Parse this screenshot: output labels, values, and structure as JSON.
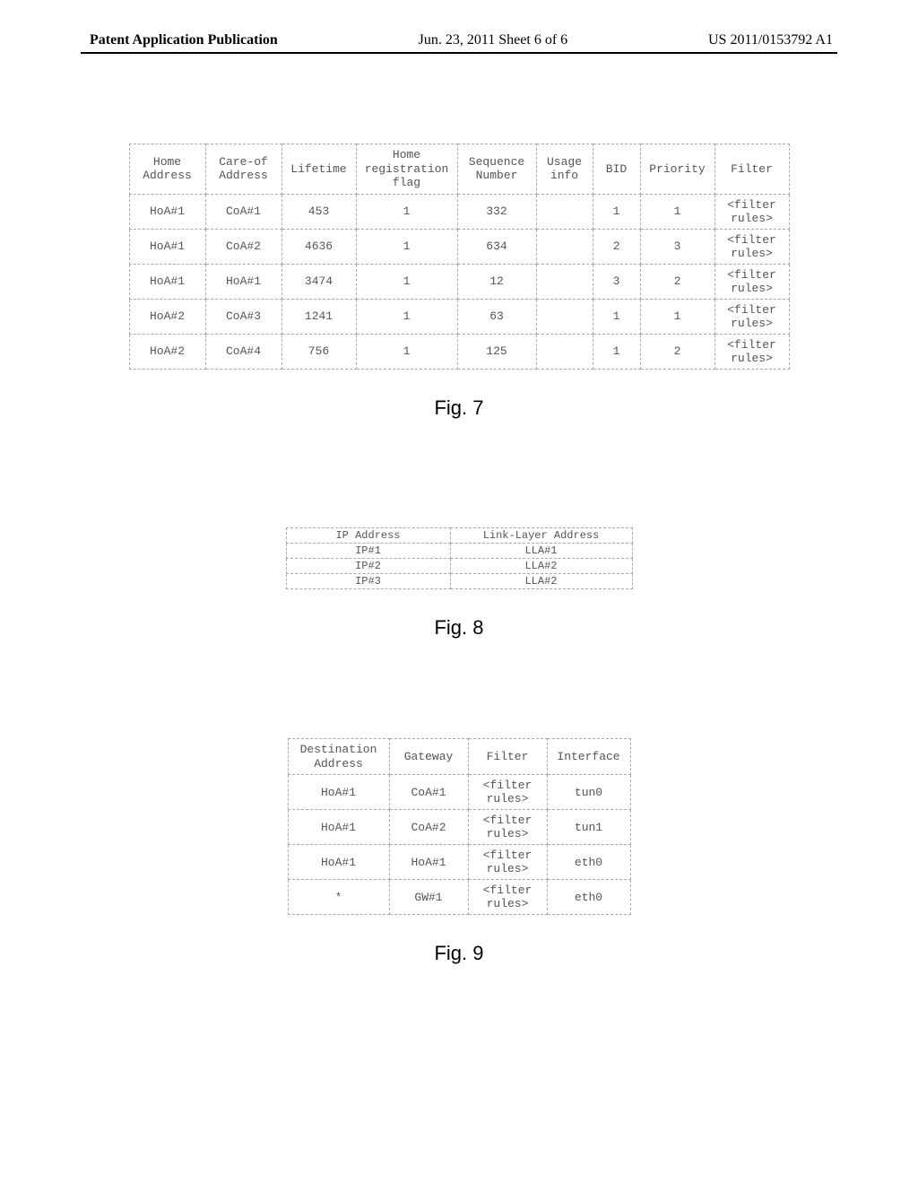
{
  "header": {
    "left": "Patent Application Publication",
    "center": "Jun. 23, 2011  Sheet 6 of 6",
    "right": "US 2011/0153792 A1"
  },
  "fig7": {
    "caption": "Fig. 7",
    "headers": [
      "Home Address",
      "Care-of Address",
      "Lifetime",
      "Home registration flag",
      "Sequence Number",
      "Usage info",
      "BID",
      "Priority",
      "Filter"
    ],
    "rows": [
      [
        "HoA#1",
        "CoA#1",
        "453",
        "1",
        "332",
        "",
        "1",
        "1",
        "<filter rules>"
      ],
      [
        "HoA#1",
        "CoA#2",
        "4636",
        "1",
        "634",
        "",
        "2",
        "3",
        "<filter rules>"
      ],
      [
        "HoA#1",
        "HoA#1",
        "3474",
        "1",
        "12",
        "",
        "3",
        "2",
        "<filter rules>"
      ],
      [
        "HoA#2",
        "CoA#3",
        "1241",
        "1",
        "63",
        "",
        "1",
        "1",
        "<filter rules>"
      ],
      [
        "HoA#2",
        "CoA#4",
        "756",
        "1",
        "125",
        "",
        "1",
        "2",
        "<filter rules>"
      ]
    ]
  },
  "fig8": {
    "caption": "Fig. 8",
    "headers": [
      "IP Address",
      "Link-Layer Address"
    ],
    "rows": [
      [
        "IP#1",
        "LLA#1"
      ],
      [
        "IP#2",
        "LLA#2"
      ],
      [
        "IP#3",
        "LLA#2"
      ]
    ]
  },
  "fig9": {
    "caption": "Fig. 9",
    "headers": [
      "Destination Address",
      "Gateway",
      "Filter",
      "Interface"
    ],
    "rows": [
      [
        "HoA#1",
        "CoA#1",
        "<filter rules>",
        "tun0"
      ],
      [
        "HoA#1",
        "CoA#2",
        "<filter rules>",
        "tun1"
      ],
      [
        "HoA#1",
        "HoA#1",
        "<filter rules>",
        "eth0"
      ],
      [
        "*",
        "GW#1",
        "<filter rules>",
        "eth0"
      ]
    ]
  }
}
